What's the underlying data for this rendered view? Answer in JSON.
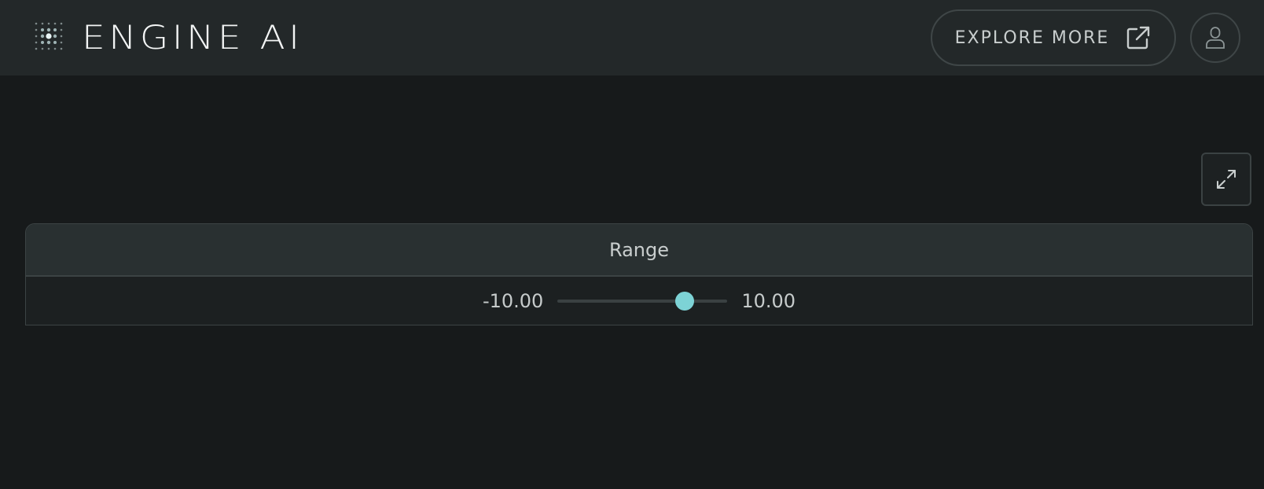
{
  "brand": {
    "name": "ENGINE AI",
    "logo_icon": "dot-grid-logo-icon"
  },
  "header": {
    "explore_label": "EXPLORE MORE",
    "explore_icon": "external-link-icon",
    "user_icon": "user-icon"
  },
  "toolbar": {
    "fullscreen_icon": "expand-icon"
  },
  "range": {
    "title": "Range",
    "min_label": "-10.00",
    "max_label": "10.00",
    "min": -10,
    "max": 10,
    "value": 5
  },
  "colors": {
    "background": "#171a1b",
    "header": "#232829",
    "accent": "#7dd3d6",
    "border": "#3c4344"
  }
}
